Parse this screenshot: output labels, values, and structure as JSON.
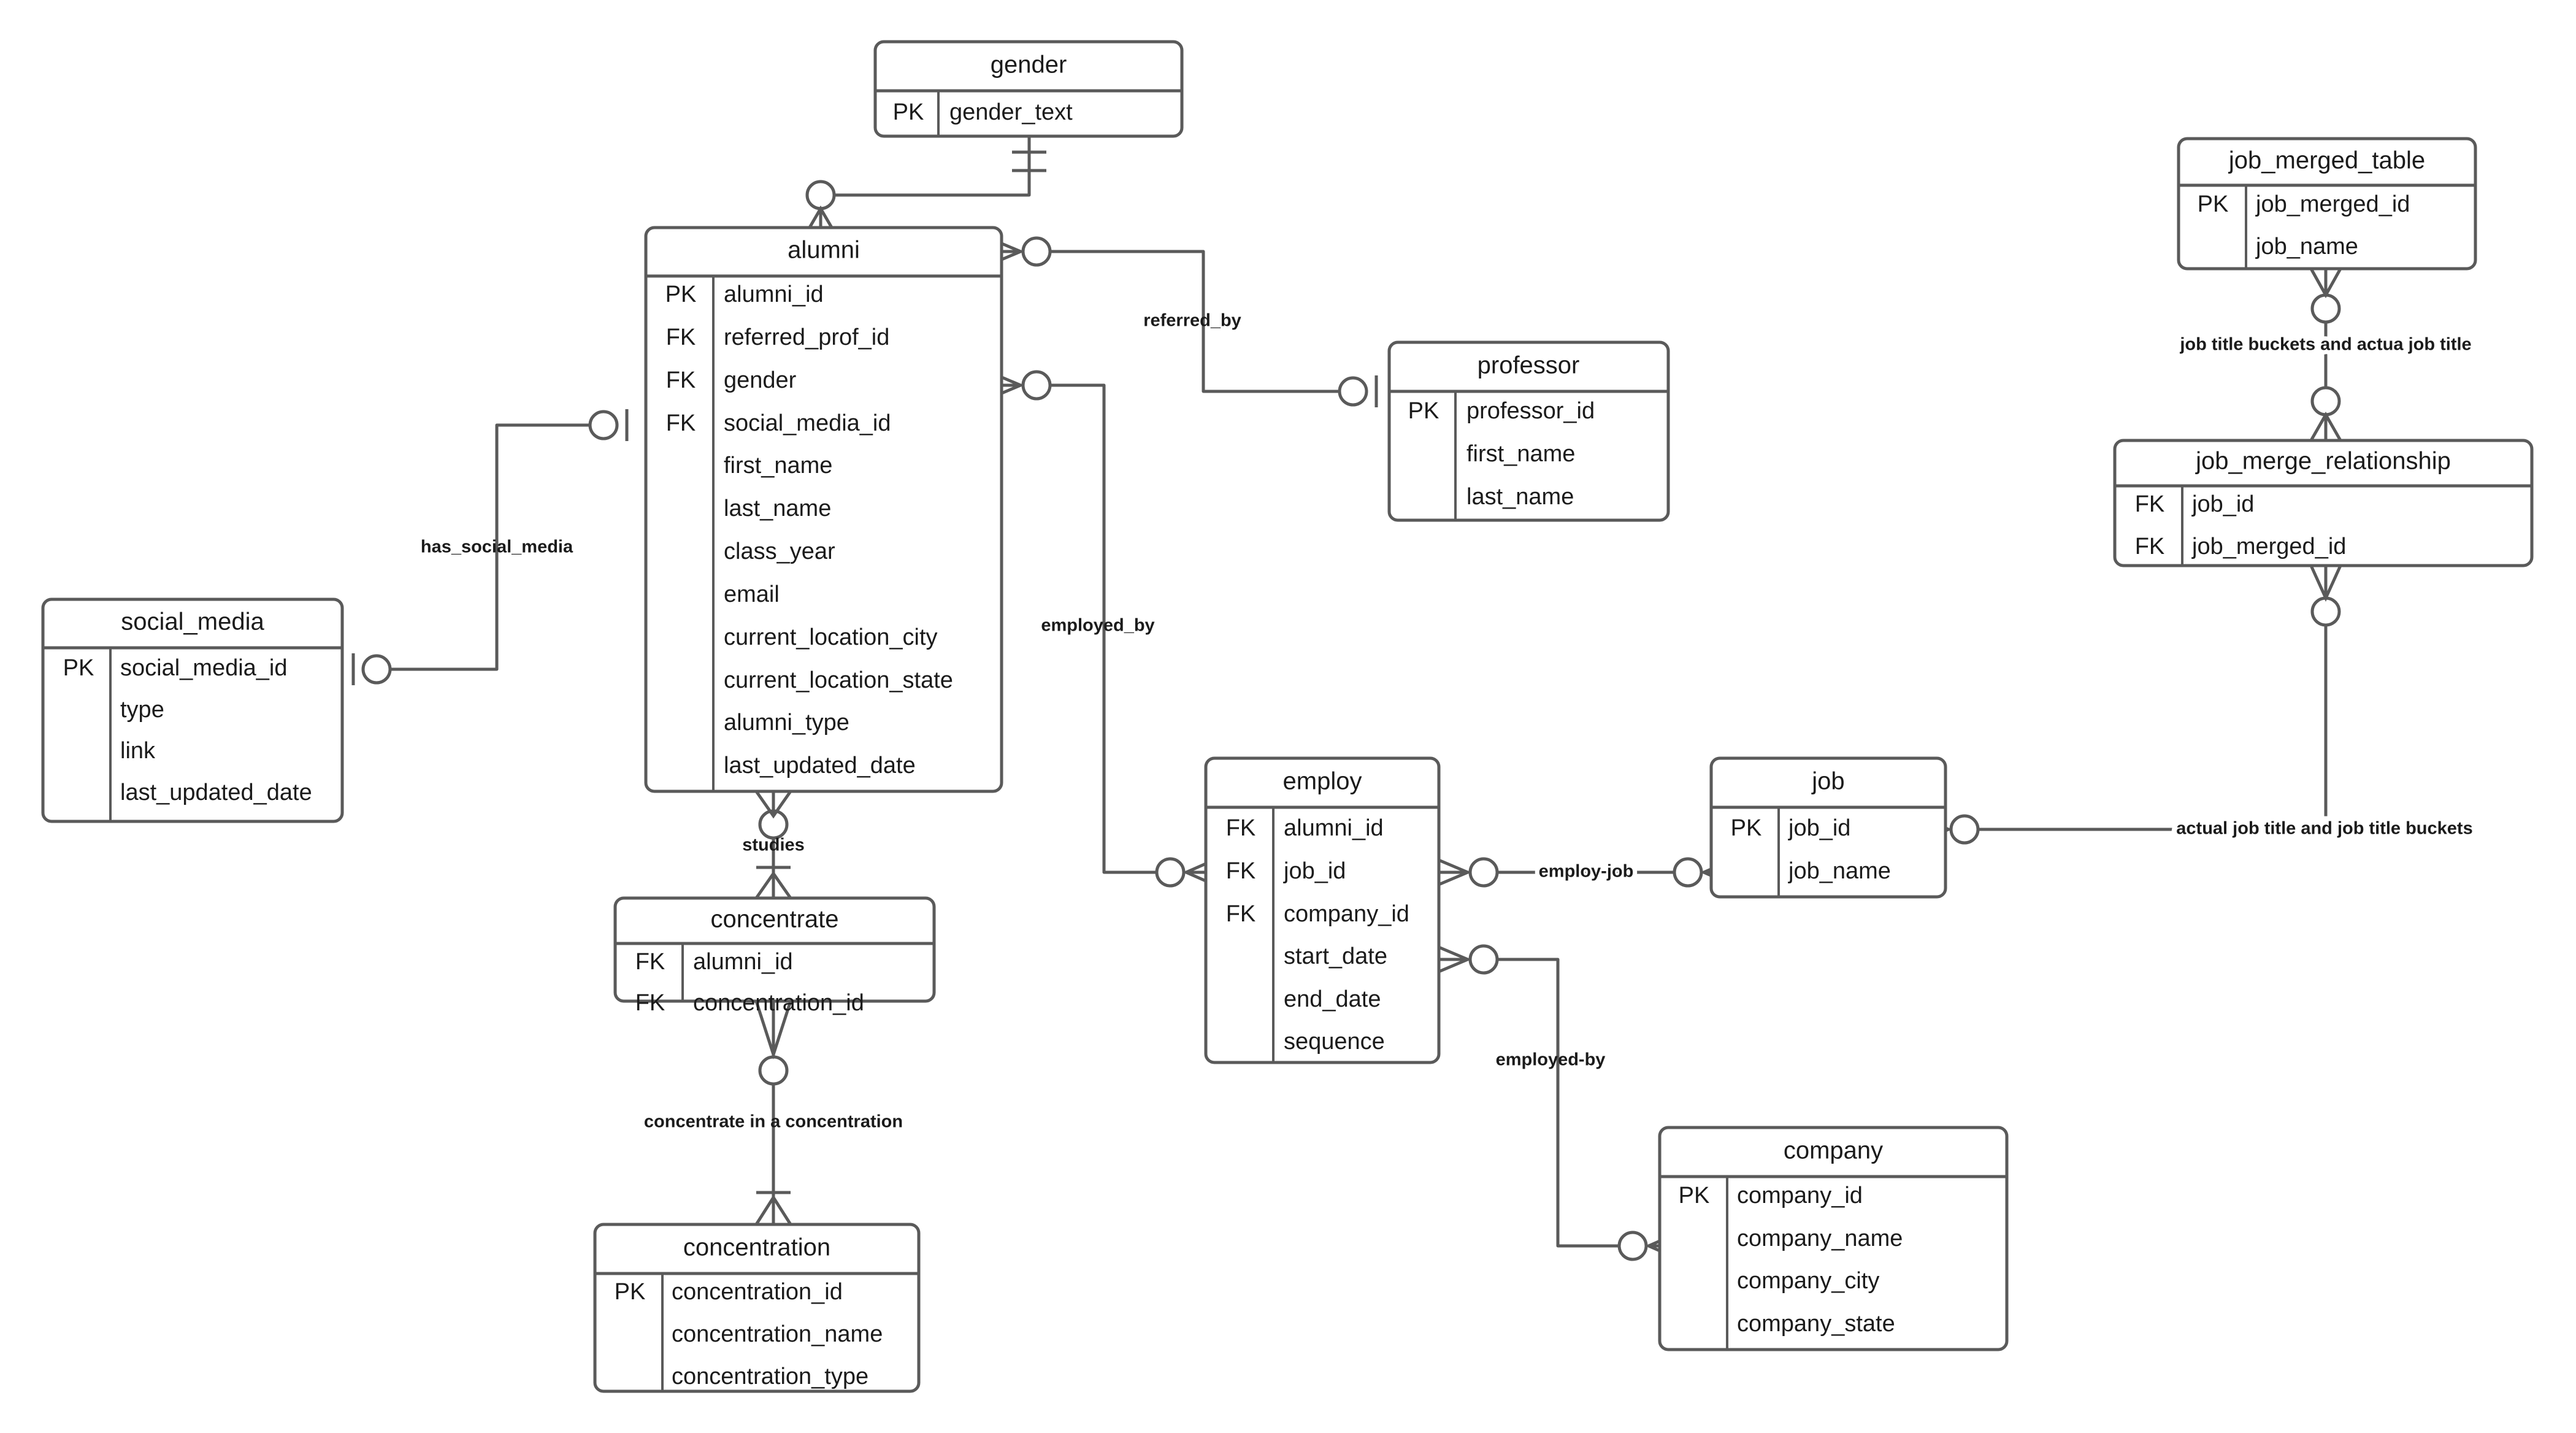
{
  "diagram": {
    "type": "entity-relationship-diagram",
    "background_color": "#ffffff",
    "line_color": "#5a5a5a",
    "text_color": "#1b1b1b"
  },
  "entities": {
    "gender": {
      "name": "gender",
      "attributes": [
        {
          "key": "PK",
          "name": "gender_text"
        }
      ]
    },
    "alumni": {
      "name": "alumni",
      "attributes": [
        {
          "key": "PK",
          "name": "alumni_id"
        },
        {
          "key": "FK",
          "name": "referred_prof_id"
        },
        {
          "key": "FK",
          "name": "gender"
        },
        {
          "key": "FK",
          "name": "social_media_id"
        },
        {
          "key": "",
          "name": "first_name"
        },
        {
          "key": "",
          "name": "last_name"
        },
        {
          "key": "",
          "name": "class_year"
        },
        {
          "key": "",
          "name": "email"
        },
        {
          "key": "",
          "name": "current_location_city"
        },
        {
          "key": "",
          "name": "current_location_state"
        },
        {
          "key": "",
          "name": "alumni_type"
        },
        {
          "key": "",
          "name": "last_updated_date"
        }
      ]
    },
    "professor": {
      "name": "professor",
      "attributes": [
        {
          "key": "PK",
          "name": "professor_id"
        },
        {
          "key": "",
          "name": "first_name"
        },
        {
          "key": "",
          "name": "last_name"
        }
      ]
    },
    "social_media": {
      "name": "social_media",
      "attributes": [
        {
          "key": "PK",
          "name": "social_media_id"
        },
        {
          "key": "",
          "name": "type"
        },
        {
          "key": "",
          "name": "link"
        },
        {
          "key": "",
          "name": "last_updated_date"
        }
      ]
    },
    "concentrate": {
      "name": "concentrate",
      "attributes": [
        {
          "key": "FK",
          "name": "alumni_id"
        },
        {
          "key": "FK",
          "name": "concentration_id"
        }
      ]
    },
    "concentration": {
      "name": "concentration",
      "attributes": [
        {
          "key": "PK",
          "name": "concentration_id"
        },
        {
          "key": "",
          "name": "concentration_name"
        },
        {
          "key": "",
          "name": "concentration_type"
        }
      ]
    },
    "employ": {
      "name": "employ",
      "attributes": [
        {
          "key": "FK",
          "name": "alumni_id"
        },
        {
          "key": "FK",
          "name": "job_id"
        },
        {
          "key": "FK",
          "name": "company_id"
        },
        {
          "key": "",
          "name": "start_date"
        },
        {
          "key": "",
          "name": "end_date"
        },
        {
          "key": "",
          "name": "sequence"
        }
      ]
    },
    "job": {
      "name": "job",
      "attributes": [
        {
          "key": "PK",
          "name": "job_id"
        },
        {
          "key": "",
          "name": "job_name"
        }
      ]
    },
    "company": {
      "name": "company",
      "attributes": [
        {
          "key": "PK",
          "name": "company_id"
        },
        {
          "key": "",
          "name": "company_name"
        },
        {
          "key": "",
          "name": "company_city"
        },
        {
          "key": "",
          "name": "company_state"
        }
      ]
    },
    "job_merged_table": {
      "name": "job_merged_table",
      "attributes": [
        {
          "key": "PK",
          "name": "job_merged_id"
        },
        {
          "key": "",
          "name": "job_name"
        }
      ]
    },
    "job_merge_relationship": {
      "name": "job_merge_relationship",
      "attributes": [
        {
          "key": "FK",
          "name": "job_id"
        },
        {
          "key": "FK",
          "name": "job_merged_id"
        }
      ]
    }
  },
  "relationships": {
    "gender_alumni": {
      "label": "",
      "from": "gender",
      "to": "alumni"
    },
    "referred_by": {
      "label": "referred_by",
      "from": "alumni",
      "to": "professor"
    },
    "employed_by": {
      "label": "employed_by",
      "from": "alumni",
      "to": "employ"
    },
    "has_social_media": {
      "label": "has_social_media",
      "from": "social_media",
      "to": "alumni"
    },
    "studies": {
      "label": "studies",
      "from": "alumni",
      "to": "concentrate"
    },
    "concentrate_in_a_concentration": {
      "label": "concentrate in a concentration",
      "from": "concentrate",
      "to": "concentration"
    },
    "employ_job": {
      "label": "employ-job",
      "from": "employ",
      "to": "job"
    },
    "employed_by_company": {
      "label": "employed-by",
      "from": "employ",
      "to": "company"
    },
    "job_title_buckets_and_actua_job_title": {
      "label": "job title buckets and actua job title",
      "from": "job_merged_table",
      "to": "job_merge_relationship"
    },
    "actual_job_title_and_job_title_buckets": {
      "label": "actual job title and job title buckets",
      "from": "job",
      "to": "job_merge_relationship"
    }
  }
}
